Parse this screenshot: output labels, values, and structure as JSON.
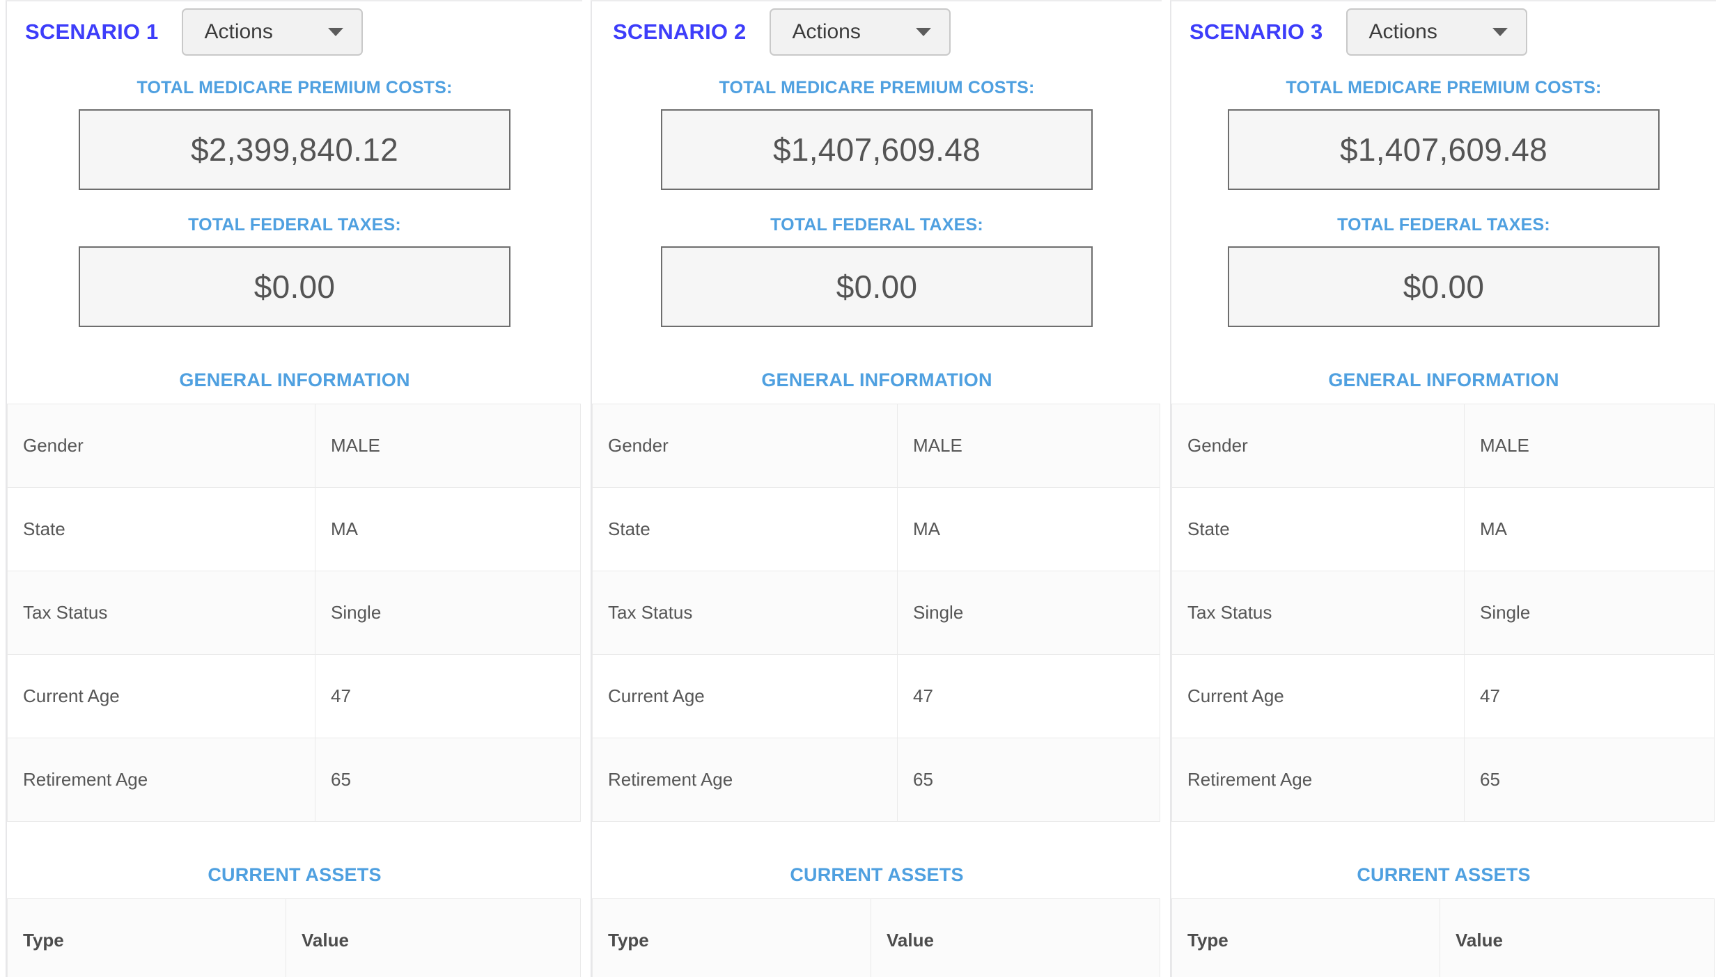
{
  "app": {
    "accent_blue": "#4fa0e0",
    "scenario_title_color": "#3d3dfa",
    "text_gray": "#565656"
  },
  "scenarios": [
    {
      "title": "SCENARIO 1",
      "actions_label": "Actions",
      "metrics": [
        {
          "label": "TOTAL MEDICARE PREMIUM COSTS:",
          "value": "$2,399,840.12"
        },
        {
          "label": "TOTAL FEDERAL TAXES:",
          "value": "$0.00"
        }
      ],
      "general_information": {
        "section_title": "GENERAL INFORMATION",
        "rows": [
          {
            "label": "Gender",
            "value": "MALE"
          },
          {
            "label": "State",
            "value": "MA"
          },
          {
            "label": "Tax Status",
            "value": "Single"
          },
          {
            "label": "Current Age",
            "value": "47"
          },
          {
            "label": "Retirement Age",
            "value": "65"
          }
        ]
      },
      "current_assets": {
        "section_title": "CURRENT ASSETS",
        "columns": [
          "Type",
          "Value"
        ]
      }
    },
    {
      "title": "SCENARIO 2",
      "actions_label": "Actions",
      "metrics": [
        {
          "label": "TOTAL MEDICARE PREMIUM COSTS:",
          "value": "$1,407,609.48"
        },
        {
          "label": "TOTAL FEDERAL TAXES:",
          "value": "$0.00"
        }
      ],
      "general_information": {
        "section_title": "GENERAL INFORMATION",
        "rows": [
          {
            "label": "Gender",
            "value": "MALE"
          },
          {
            "label": "State",
            "value": "MA"
          },
          {
            "label": "Tax Status",
            "value": "Single"
          },
          {
            "label": "Current Age",
            "value": "47"
          },
          {
            "label": "Retirement Age",
            "value": "65"
          }
        ]
      },
      "current_assets": {
        "section_title": "CURRENT ASSETS",
        "columns": [
          "Type",
          "Value"
        ]
      }
    },
    {
      "title": "SCENARIO 3",
      "actions_label": "Actions",
      "metrics": [
        {
          "label": "TOTAL MEDICARE PREMIUM COSTS:",
          "value": "$1,407,609.48"
        },
        {
          "label": "TOTAL FEDERAL TAXES:",
          "value": "$0.00"
        }
      ],
      "general_information": {
        "section_title": "GENERAL INFORMATION",
        "rows": [
          {
            "label": "Gender",
            "value": "MALE"
          },
          {
            "label": "State",
            "value": "MA"
          },
          {
            "label": "Tax Status",
            "value": "Single"
          },
          {
            "label": "Current Age",
            "value": "47"
          },
          {
            "label": "Retirement Age",
            "value": "65"
          }
        ]
      },
      "current_assets": {
        "section_title": "CURRENT ASSETS",
        "columns": [
          "Type",
          "Value"
        ]
      }
    }
  ]
}
